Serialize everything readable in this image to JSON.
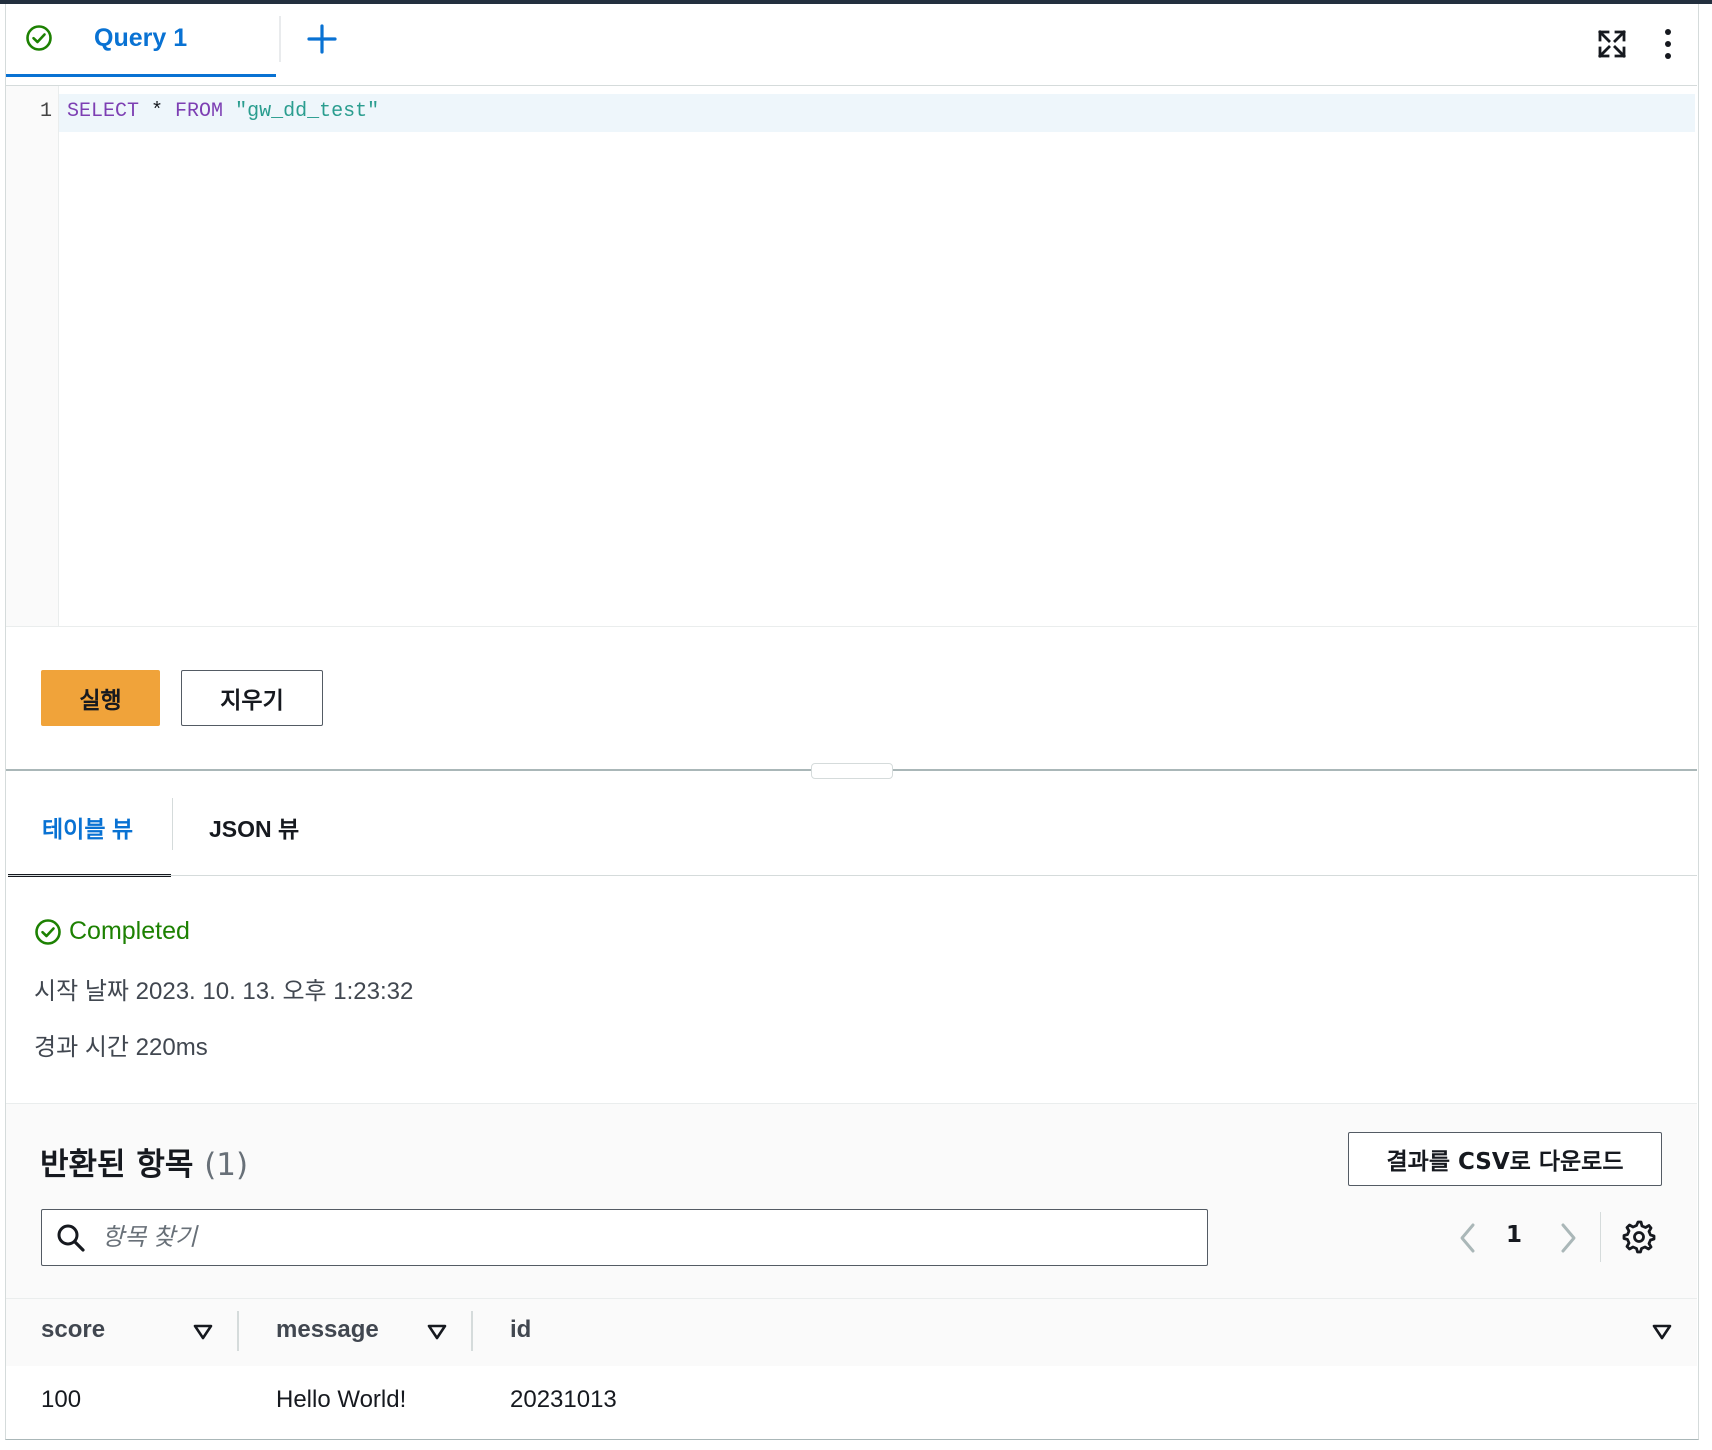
{
  "editor_tabs": {
    "query_tab_label": "Query 1"
  },
  "editor": {
    "line_number": "1",
    "code_tokens": {
      "select": "SELECT",
      "star": " * ",
      "from": "FROM",
      "space": " ",
      "table": "\"gw_dd_test\""
    }
  },
  "actions": {
    "run_label": "실행",
    "clear_label": "지우기"
  },
  "result_tabs": {
    "table_view": "테이블 뷰",
    "json_view": "JSON 뷰"
  },
  "status": {
    "state": "Completed",
    "start_time": "시작 날짜 2023. 10. 13. 오후 1:23:32",
    "elapsed": "경과 시간 220ms"
  },
  "results": {
    "title": "반환된 항목",
    "count": "(1)",
    "download_label": "결과를 CSV로 다운로드",
    "search_placeholder": "항목 찾기",
    "current_page": "1",
    "columns": [
      "score",
      "message",
      "id"
    ],
    "rows": [
      [
        "100",
        "Hello World!",
        "20231013"
      ]
    ]
  },
  "colors": {
    "accent": "#0972d3",
    "run_button": "#f0a33a",
    "success": "#1d8102",
    "keyword": "#7d3fb3",
    "string": "#2a9d8f"
  },
  "icons": {
    "tab_status": "check-circle-icon",
    "add_tab": "plus-icon",
    "fullscreen": "expand-icon",
    "more": "vertical-dots-icon",
    "search": "search-icon",
    "prev": "chevron-left-icon",
    "next": "chevron-right-icon",
    "settings": "gear-icon",
    "sort": "caret-down-icon"
  }
}
